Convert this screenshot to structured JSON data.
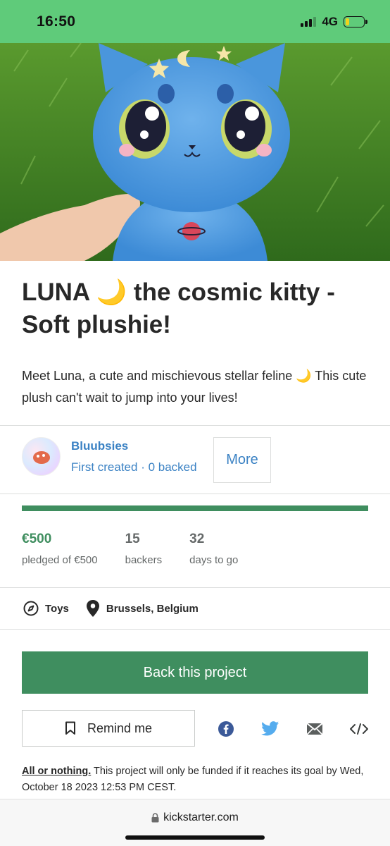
{
  "status_bar": {
    "time": "16:50",
    "network": "4G"
  },
  "project": {
    "title": "LUNA 🌙 the cosmic kitty - Soft plushie!",
    "blurb": "Meet Luna, a cute and mischievous stellar feline 🌙 This cute plush can't wait to jump into your lives!"
  },
  "creator": {
    "name": "Bluubsies",
    "meta": "First created · 0 backed",
    "more_label": "More"
  },
  "funding": {
    "progress_fraction": 1.0,
    "pledged": "€500",
    "pledged_label": "pledged of €500",
    "backers": "15",
    "backers_label": "backers",
    "days": "32",
    "days_label": "days to go"
  },
  "tags": {
    "category": "Toys",
    "location": "Brussels, Belgium"
  },
  "actions": {
    "back_label": "Back this project",
    "remind_label": "Remind me"
  },
  "fine_print": {
    "aon": "All or nothing.",
    "text": " This project will only be funded if it reaches its goal by Wed, October 18 2023 12:53 PM CEST."
  },
  "browser": {
    "url": "kickstarter.com"
  },
  "colors": {
    "status_bar": "#5fcb7a",
    "brand_green": "#3f8e5f",
    "link_blue": "#3b82c4",
    "facebook": "#3b5998",
    "twitter": "#55acee"
  }
}
